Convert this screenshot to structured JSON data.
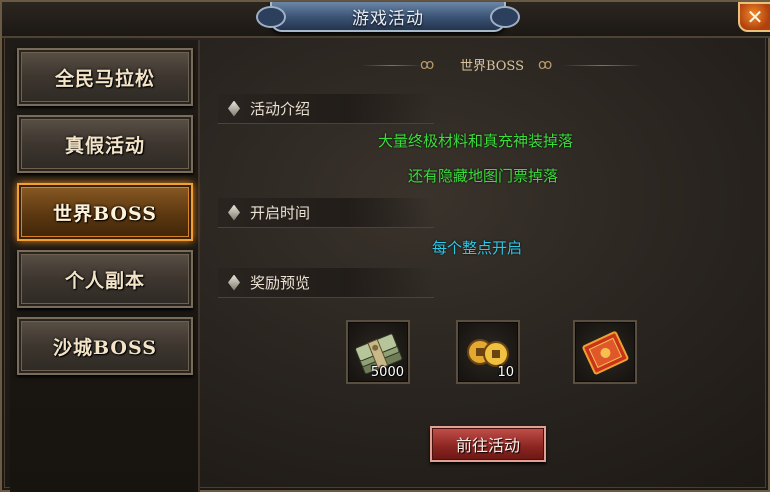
{
  "window": {
    "title": "游戏活动"
  },
  "close": {
    "glyph": "✕"
  },
  "sidebar": {
    "items": [
      {
        "label": "全民马拉松",
        "active": false
      },
      {
        "label": "真假活动",
        "active": false
      },
      {
        "label": "世界BOSS",
        "active": true
      },
      {
        "label": "个人副本",
        "active": false
      },
      {
        "label": "沙城BOSS",
        "active": false
      }
    ]
  },
  "content": {
    "title": "世界BOSS",
    "sections": {
      "intro": {
        "heading": "活动介绍",
        "lines": [
          "大量终极材料和真充神装掉落",
          "还有隐藏地图门票掉落"
        ]
      },
      "time": {
        "heading": "开启时间",
        "text": "每个整点开启"
      },
      "rewards": {
        "heading": "奖励预览",
        "items": [
          {
            "icon": "cash-bundle-icon",
            "qty": "5000"
          },
          {
            "icon": "gold-coins-icon",
            "qty": "10"
          },
          {
            "icon": "red-envelope-icon",
            "qty": ""
          }
        ]
      }
    },
    "go_button": "前往活动"
  },
  "colors": {
    "green_text": "#3bdc3b",
    "cyan_text": "#2bc9e8",
    "active_tab_border": "#f2a033",
    "title_plate": "#3a5274",
    "go_button": "#8a2420"
  }
}
